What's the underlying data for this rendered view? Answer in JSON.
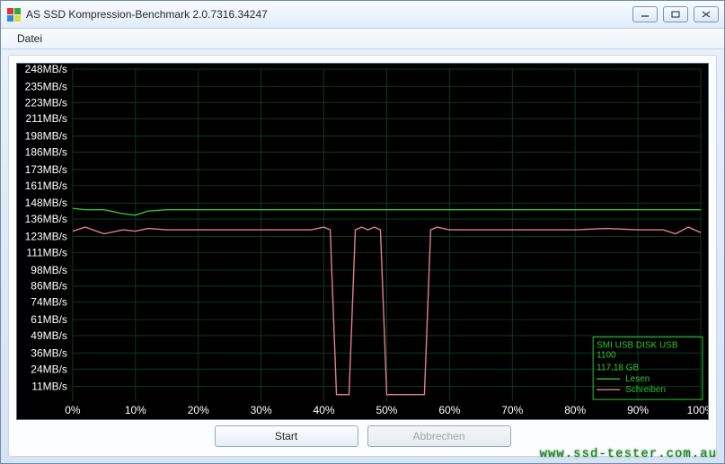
{
  "window": {
    "title": "AS SSD Kompression-Benchmark 2.0.7316.34247"
  },
  "menu": {
    "file": "Datei"
  },
  "buttons": {
    "start": "Start",
    "cancel": "Abbrechen"
  },
  "legend": {
    "device_line1": "SMI USB DISK USB",
    "device_line2": "1100",
    "capacity": "117,18 GB",
    "read": "Lesen",
    "write": "Schreiben"
  },
  "watermark": "www.ssd-tester.com.au",
  "chart_data": {
    "type": "line",
    "xlabel": "",
    "ylabel": "",
    "x_unit": "%",
    "y_unit": "MB/s",
    "xlim": [
      0,
      100
    ],
    "ylim": [
      0,
      248
    ],
    "x_ticks": [
      0,
      10,
      20,
      30,
      40,
      50,
      60,
      70,
      80,
      90,
      100
    ],
    "y_ticks": [
      11,
      24,
      36,
      49,
      61,
      74,
      86,
      98,
      111,
      123,
      136,
      148,
      161,
      173,
      186,
      198,
      211,
      223,
      235,
      248
    ],
    "y_tick_labels": [
      "11MB/s",
      "24MB/s",
      "36MB/s",
      "49MB/s",
      "61MB/s",
      "74MB/s",
      "86MB/s",
      "98MB/s",
      "111MB/s",
      "123MB/s",
      "136MB/s",
      "148MB/s",
      "161MB/s",
      "173MB/s",
      "186MB/s",
      "198MB/s",
      "211MB/s",
      "223MB/s",
      "235MB/s",
      "248MB/s"
    ],
    "x_tick_labels": [
      "0%",
      "10%",
      "20%",
      "30%",
      "40%",
      "50%",
      "60%",
      "70%",
      "80%",
      "90%",
      "100%"
    ],
    "series": [
      {
        "name": "Lesen",
        "color": "#2fc52f",
        "x": [
          0,
          2,
          5,
          8,
          10,
          12,
          15,
          20,
          25,
          30,
          35,
          40,
          45,
          50,
          55,
          60,
          65,
          70,
          75,
          80,
          85,
          90,
          95,
          100
        ],
        "y": [
          144,
          143,
          143,
          140,
          139,
          142,
          143,
          143,
          143,
          143,
          143,
          143,
          143,
          143,
          143,
          143,
          143,
          143,
          143,
          143,
          143,
          143,
          143,
          143
        ]
      },
      {
        "name": "Schreiben",
        "color": "#e37f8a",
        "x": [
          0,
          2,
          5,
          8,
          10,
          12,
          15,
          20,
          25,
          30,
          35,
          38,
          40,
          41,
          42,
          43,
          44,
          45,
          46,
          47,
          48,
          49,
          50,
          51,
          52,
          53,
          54,
          55,
          56,
          57,
          58,
          60,
          65,
          70,
          75,
          80,
          85,
          90,
          94,
          96,
          98,
          100
        ],
        "y": [
          127,
          130,
          125,
          128,
          127,
          129,
          128,
          128,
          128,
          128,
          128,
          128,
          130,
          128,
          5,
          5,
          5,
          128,
          130,
          128,
          130,
          128,
          5,
          5,
          5,
          5,
          5,
          5,
          5,
          128,
          130,
          128,
          128,
          128,
          128,
          128,
          129,
          128,
          128,
          125,
          130,
          126
        ]
      }
    ]
  }
}
